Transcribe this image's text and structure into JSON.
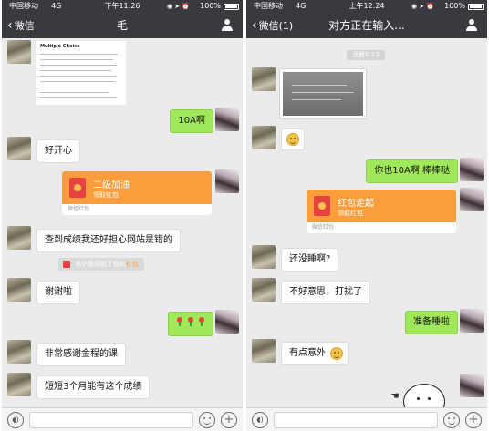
{
  "left": {
    "status": {
      "carrier": "中国移动",
      "network": "4G",
      "time": "下午11:26",
      "battery": "100%"
    },
    "nav": {
      "back": "微信",
      "title": "毛"
    },
    "document": {
      "heading": "Multiple Choice",
      "lines": [
        "Alternative Investments",
        "Corporate Finance",
        "Derivatives",
        "Economics",
        "Equity Investments",
        "Ethical & Professional",
        "Fixed Income",
        "Financial Reporting",
        "Portfolio Management",
        "Quantitative Methods"
      ]
    },
    "messages": {
      "m1": "10A啊",
      "m2": "好开心",
      "m3": "查到成绩我还好担心网站是错的",
      "m4": "谢谢啦",
      "m5": "非常感谢金程的课",
      "m6": "短短3个月能有这个成绩"
    },
    "red_packet": {
      "title": "二级加油",
      "subtitle": "领取红包",
      "footer": "微信红包"
    },
    "system_note": {
      "text": "毛小姐领取了你的",
      "highlight": "红包"
    }
  },
  "right": {
    "status": {
      "carrier": "中国移动",
      "network": "4G",
      "time": "上午12:24",
      "battery": "100%"
    },
    "nav": {
      "back": "微信(1)",
      "title": "对方正在输入..."
    },
    "timestamp": "凌晨0:23",
    "messages": {
      "m1": "你也10A啊 棒棒哒",
      "m2": "还没睡啊?",
      "m3": "不好意思，打扰了",
      "m4": "准备睡啦",
      "m5": "有点意外"
    },
    "red_packet": {
      "title": "红包走起",
      "subtitle": "领取红包",
      "footer": "微信红包"
    }
  },
  "icons": {
    "back": "chevron-left-icon",
    "contact": "person-icon",
    "voice": "voice-icon",
    "emoji": "emoji-icon",
    "plus": "plus-icon",
    "red_packet": "red-packet-icon",
    "flower": "rose-emoji-icon",
    "smile": "smile-emoji-icon"
  },
  "colors": {
    "nav_bg": "#393a3f",
    "chat_bg": "#ebebeb",
    "sent_bubble": "#a0e75a",
    "received_bubble": "#ffffff",
    "red_packet": "#fa9d3b"
  }
}
